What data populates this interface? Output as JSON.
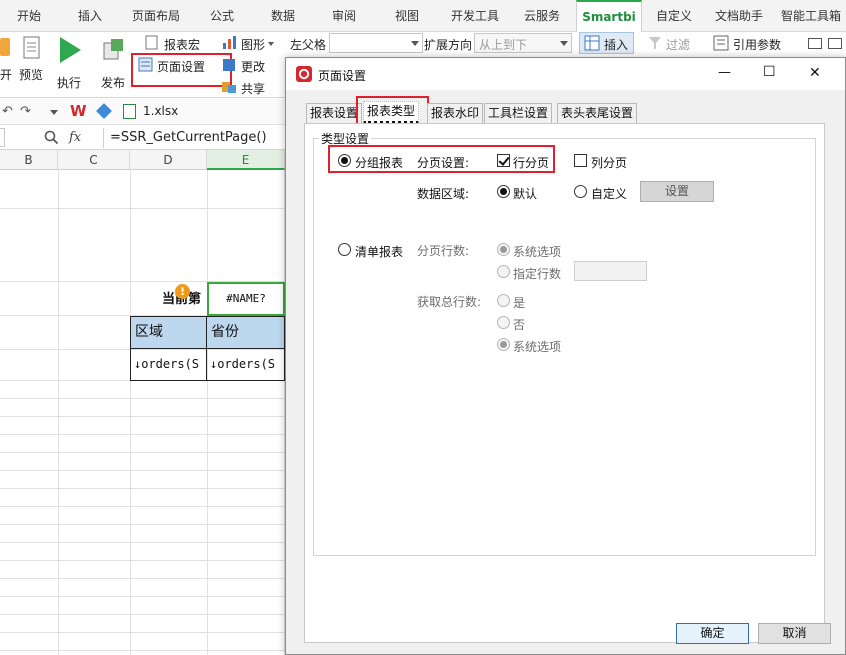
{
  "ribbon": {
    "tabs": [
      "开始",
      "插入",
      "页面布局",
      "公式",
      "数据",
      "审阅",
      "视图",
      "开发工具",
      "云服务",
      "Smartbi",
      "自定义",
      "文档助手",
      "智能工具箱"
    ],
    "active_tab": "Smartbi",
    "groups": {
      "open_label": "开",
      "preview_label": "预览",
      "execute_label": "执行",
      "publish_label": "发布",
      "report_macro_label": "报表宏",
      "page_setup_label": "页面设置",
      "graphics_label": "图形",
      "change_label": "更改",
      "share_label": "共享",
      "left_parent_label": "左父格",
      "left_parent_value": "",
      "expand_direction_label": "扩展方向",
      "expand_direction_value": "从上到下",
      "insert_label": "插入",
      "filter_label": "过滤",
      "ref_param_label": "引用参数"
    },
    "accent_color": "#2aa84b",
    "highlight_color": "#e0202a"
  },
  "quickbar": {
    "file_name": "1.xlsx"
  },
  "formula_bar": {
    "fx_label": "fx",
    "formula": "=SSR_GetCurrentPage()"
  },
  "sheet": {
    "columns": [
      "B",
      "C",
      "D",
      "E"
    ],
    "selected_column": "E",
    "cells": {
      "current_page_label": "当前第",
      "name_error": "#NAME?",
      "header_region": "区域",
      "header_province": "省份",
      "data_region": "↓orders(S",
      "data_province": "↓orders(S"
    }
  },
  "dialog": {
    "title": "页面设置",
    "window_controls": {
      "minimize": "—",
      "maximize": "☐",
      "close": "✕"
    },
    "tabs": [
      "报表设置",
      "报表类型",
      "报表水印",
      "工具栏设置",
      "表头表尾设置"
    ],
    "active_tab": "报表类型",
    "group_label": "类型设置",
    "group_report": {
      "label": "分组报表",
      "selected": true,
      "paging_label": "分页设置:",
      "row_paging": {
        "label": "行分页",
        "checked": true
      },
      "col_paging": {
        "label": "列分页",
        "checked": false
      },
      "data_area_label": "数据区域:",
      "data_area_default": {
        "label": "默认",
        "selected": true
      },
      "data_area_custom": {
        "label": "自定义",
        "selected": false
      },
      "settings_button": "设置"
    },
    "list_report": {
      "label": "清单报表",
      "selected": false,
      "page_rows_label": "分页行数:",
      "system_option_label": "系统选项",
      "specified_rows_label": "指定行数",
      "specified_rows_value": "",
      "total_rows_label": "获取总行数:",
      "yes_label": "是",
      "no_label": "否",
      "system_option2_label": "系统选项"
    },
    "ok_button": "确定",
    "cancel_button": "取消"
  }
}
